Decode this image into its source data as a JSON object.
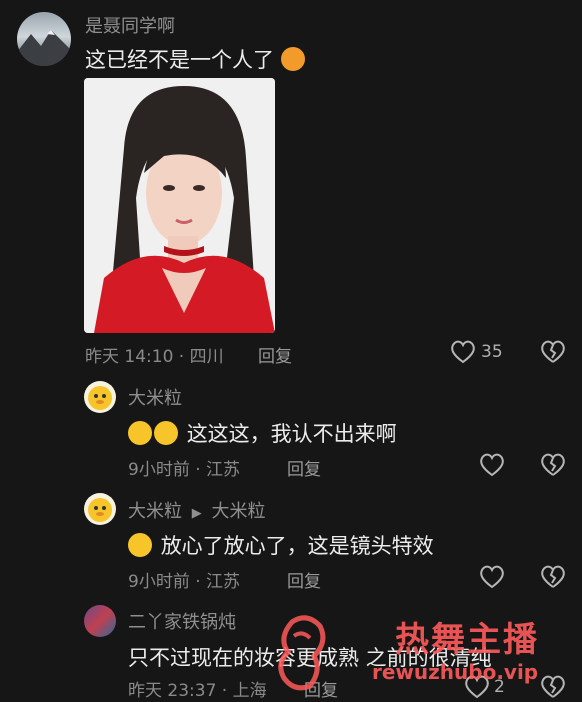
{
  "comments": [
    {
      "author": "是聂同学啊",
      "text": "这已经不是一个人了",
      "time": "昨天 14:10",
      "location": "四川",
      "reply_label": "回复",
      "likes": "35"
    },
    {
      "author": "大米粒",
      "text": "这这这，我认不出来啊",
      "time": "9小时前",
      "location": "江苏",
      "reply_label": "回复"
    },
    {
      "author": "大米粒",
      "reply_to": "大米粒",
      "text": "放心了放心了，这是镜头特效",
      "time": "9小时前",
      "location": "江苏",
      "reply_label": "回复"
    },
    {
      "author": "二丫家铁锅炖",
      "text": "只不过现在的妆容更成熟 之前的很清纯",
      "time": "昨天 23:37",
      "location": "上海",
      "reply_label": "回复",
      "likes": "2"
    }
  ],
  "watermark": {
    "title": "热舞主播",
    "url": "rewuzhubo.vip"
  },
  "colors": {
    "background": "#161616",
    "text": "#ececec",
    "muted": "#8a8a8a",
    "emoji": "#f7c52a",
    "watermark": "#ff5a5a"
  },
  "icons": [
    "heart-icon",
    "broken-heart-icon",
    "reply-arrow-icon",
    "laughing-emoji-icon"
  ]
}
